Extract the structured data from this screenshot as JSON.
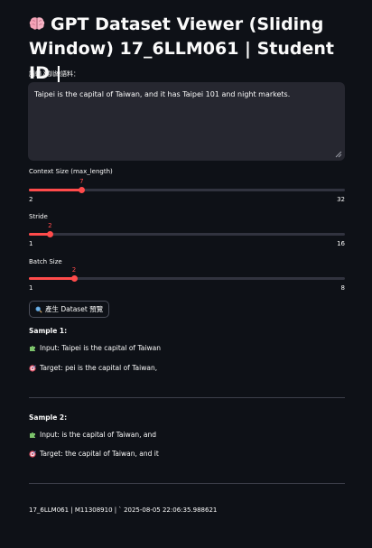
{
  "page": {
    "title": "GPT Dataset Viewer (Sliding Window) 17_6LLM061 | Student ID |"
  },
  "input": {
    "label": "請輸入訓練語料：",
    "value": "Taipei is the capital of Taiwan, and it has Taipei 101 and night markets."
  },
  "sliders": {
    "context": {
      "label": "Context Size (max_length)",
      "value": 7,
      "min": 2,
      "max": 32,
      "value_text": "7",
      "min_text": "2",
      "max_text": "32"
    },
    "stride": {
      "label": "Stride",
      "value": 2,
      "min": 1,
      "max": 16,
      "value_text": "2",
      "min_text": "1",
      "max_text": "16"
    },
    "batch": {
      "label": "Batch Size",
      "value": 2,
      "min": 1,
      "max": 8,
      "value_text": "2",
      "min_text": "1",
      "max_text": "8"
    }
  },
  "button": {
    "label": "產生 Dataset 預覽",
    "icon": "magnifier-icon"
  },
  "samples": [
    {
      "heading": "Sample 1:",
      "input": "Input: Taipei is the capital of Taiwan",
      "target": "Target: pei is the capital of Taiwan,"
    },
    {
      "heading": "Sample 2:",
      "input": "Input: is the capital of Taiwan, and",
      "target": "Target: the capital of Taiwan, and it"
    }
  ],
  "footer": {
    "text": "17_6LLM061 | M11308910 | ` 2025-08-05 22:06:35.988621"
  },
  "colors": {
    "background": "#0e1117",
    "accent": "#ff4b4b",
    "input_bg": "#262730",
    "track": "#31333f",
    "text": "#fafafa"
  }
}
